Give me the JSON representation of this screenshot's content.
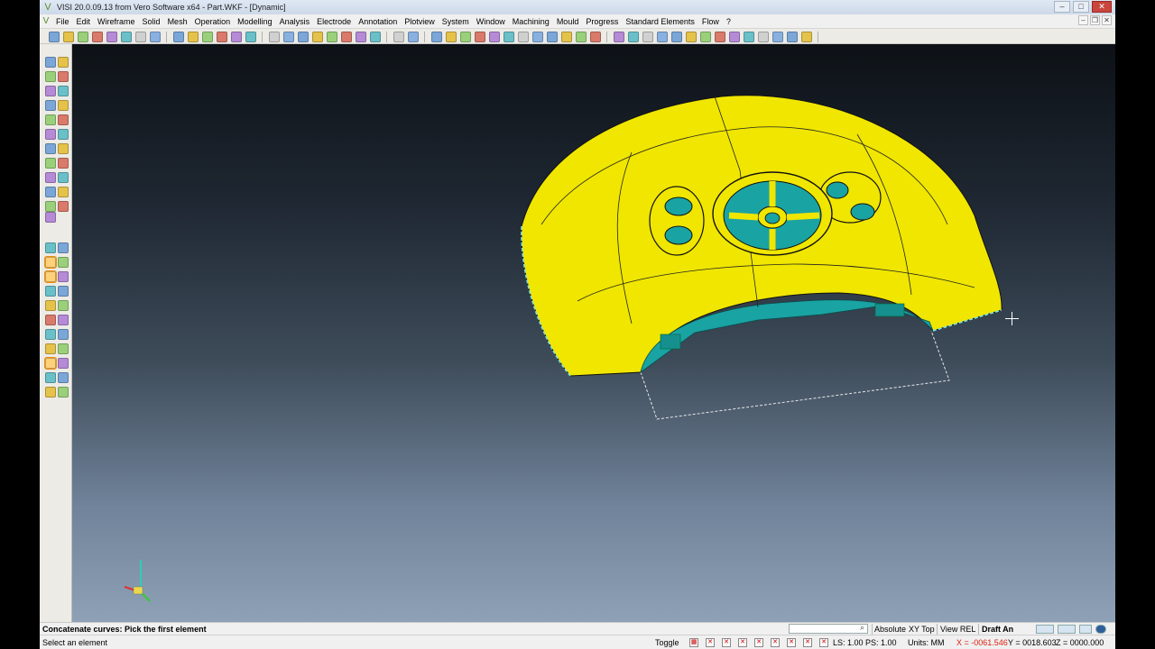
{
  "window": {
    "title": "VISI 20.0.09.13 from Vero Software x64 - Part.WKF - [Dynamic]",
    "controls": {
      "minimize": "–",
      "maximize": "□",
      "close": "✕"
    }
  },
  "menu": {
    "items": [
      "File",
      "Edit",
      "Wireframe",
      "Solid",
      "Mesh",
      "Operation",
      "Modelling",
      "Analysis",
      "Electrode",
      "Annotation",
      "Plotview",
      "System",
      "Window",
      "Machining",
      "Mould",
      "Progress",
      "Standard Elements",
      "Flow",
      "?"
    ],
    "mdi_controls": {
      "minimize": "–",
      "restore": "❐",
      "close": "✕"
    }
  },
  "toolbar": {
    "icon_names": [
      "new-icon",
      "open-icon",
      "save-icon",
      "print-icon",
      "cut-icon",
      "copy-icon",
      "paste-icon",
      "undo-icon",
      "redo-icon",
      "zoom-icon",
      "rotate-icon",
      "view-icon",
      "shade-icon",
      "layer-icon",
      "wireframe-icon",
      "surface-icon",
      "solid-icon",
      "analyze-icon",
      "machining-icon",
      "mould-icon"
    ]
  },
  "sidebar": {
    "icon_names": [
      "point-icon",
      "line-icon",
      "circle-icon",
      "arc-icon",
      "spline-icon",
      "trim-icon",
      "extend-icon",
      "offset-icon",
      "fillet-icon",
      "chamfer-icon",
      "mirror-icon",
      "rotate-icon",
      "move-icon",
      "scale-icon",
      "arrow-left-icon",
      "arrow-right-icon"
    ]
  },
  "viewport": {
    "background_top": "#0d1116",
    "background_bottom": "#8ea1b6",
    "part_color": "#f0e600",
    "cavity_color": "#1aa3a3",
    "edge_highlight_color": "#7fe3e3"
  },
  "status": {
    "prompt": "Concatenate curves: Pick the first element",
    "absolute": "Absolute",
    "xy_top": "XY Top",
    "view_rel": "View REL",
    "draft": "Draft An",
    "hint": "Select an element",
    "toggle": "Toggle",
    "ls_ps": "LS: 1.00 PS: 1.00",
    "units": "Units: MM",
    "x_coord": "X = -0061.546",
    "y_coord": "Y = 0018.603",
    "z_coord": "Z = 0000.000"
  }
}
